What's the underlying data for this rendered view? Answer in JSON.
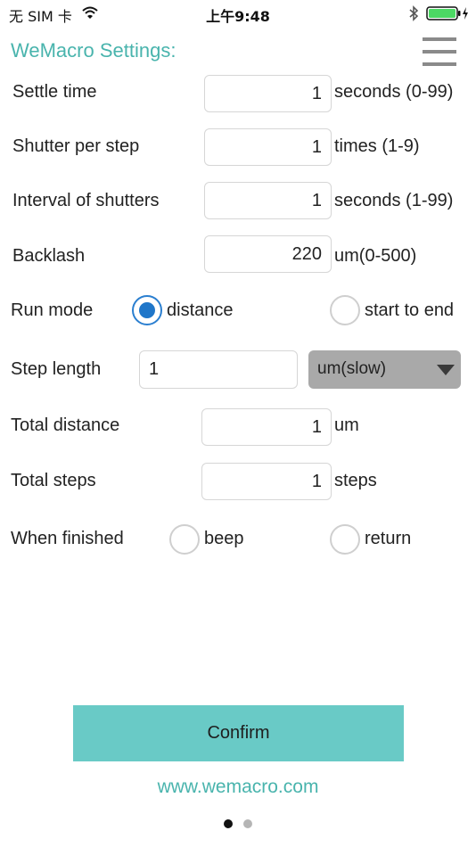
{
  "status_bar": {
    "carrier": "无 SIM 卡",
    "time": "上午9:48",
    "battery_color": "#4cd964",
    "icons": [
      "wifi-icon",
      "bluetooth-icon",
      "battery-icon",
      "charging-icon"
    ]
  },
  "header": {
    "title": "WeMacro Settings:",
    "title_color": "#49b4ad",
    "menu_icon": "hamburger-menu-icon"
  },
  "settings": {
    "settle_time": {
      "label": "Settle time",
      "value": "1",
      "unit": "seconds (0-99)"
    },
    "shutter_per_step": {
      "label": "Shutter per step",
      "value": "1",
      "unit": "times (1-9)"
    },
    "interval_of_shutters": {
      "label": "Interval of shutters",
      "value": "1",
      "unit": "seconds (1-99)"
    },
    "backlash": {
      "label": "Backlash",
      "value": "220",
      "unit": "um(0-500)"
    },
    "run_mode": {
      "label": "Run mode",
      "options": [
        {
          "label": "distance",
          "selected": true
        },
        {
          "label": "start to end",
          "selected": false
        }
      ]
    },
    "step_length": {
      "label": "Step length",
      "value": "1",
      "select_value": "um(slow)"
    },
    "total_distance": {
      "label": "Total distance",
      "value": "1",
      "unit": "um"
    },
    "total_steps": {
      "label": "Total steps",
      "value": "1",
      "unit": "steps"
    },
    "when_finished": {
      "label": "When finished",
      "options": [
        {
          "label": "beep",
          "selected": false
        },
        {
          "label": "return",
          "selected": false
        }
      ]
    }
  },
  "actions": {
    "confirm_label": "Confirm",
    "confirm_color": "#69cac6"
  },
  "footer": {
    "website": "www.wemacro.com",
    "page_indicator": {
      "total": 2,
      "current": 1
    }
  },
  "colors": {
    "accent": "#49b4ad",
    "radio_selected": "#1f76c9"
  }
}
